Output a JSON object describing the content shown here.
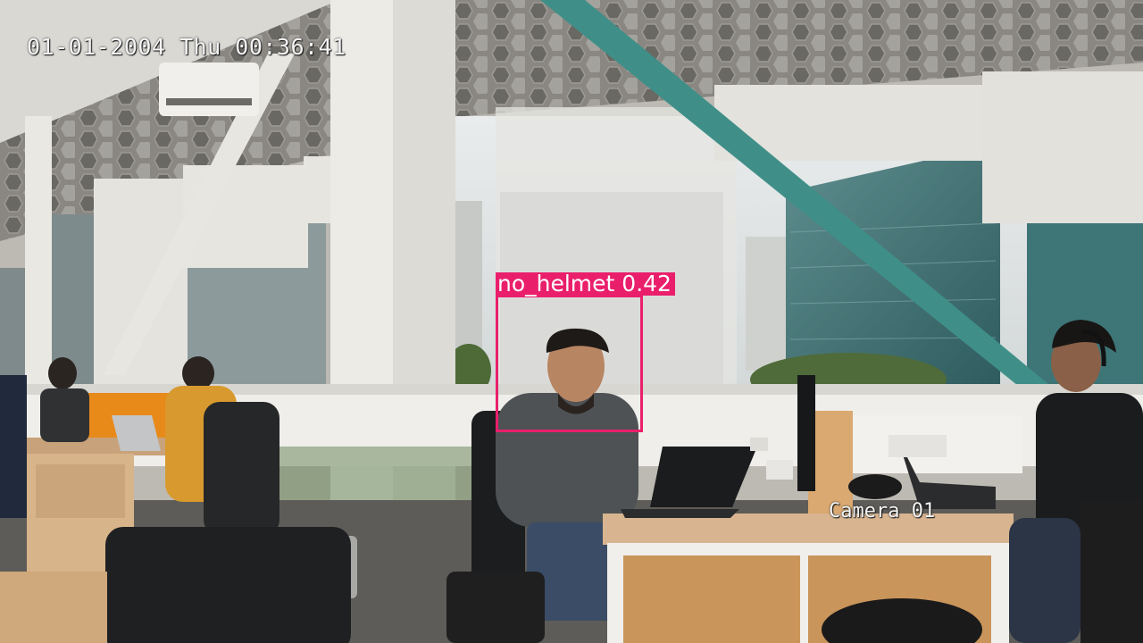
{
  "overlay": {
    "timestamp": "01-01-2004 Thu 00:36:41",
    "camera_name": "Camera 01"
  },
  "detection": {
    "label": "no_helmet 0.42",
    "color": "#ea1f6b"
  }
}
